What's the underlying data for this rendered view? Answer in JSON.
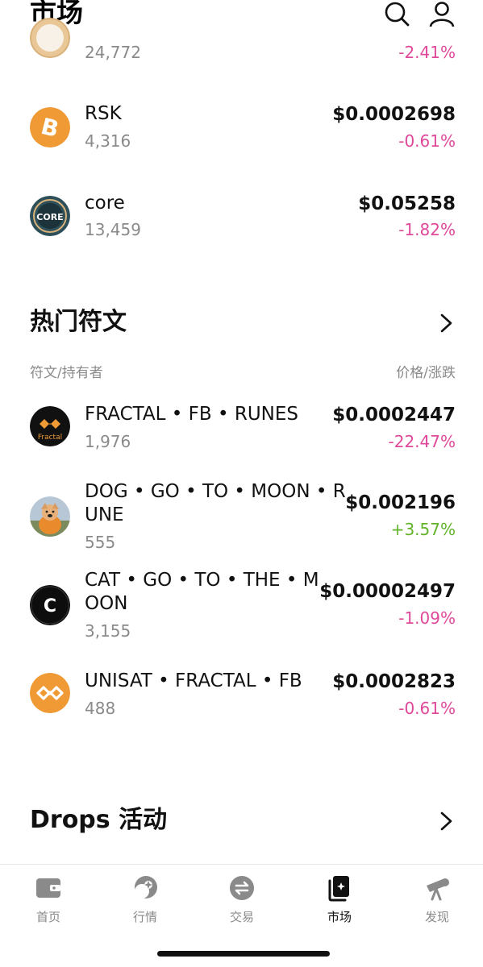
{
  "header": {
    "title": "市场",
    "search_icon": "search-icon",
    "profile_icon": "person-icon"
  },
  "top_list": [
    {
      "name": "",
      "holders": "24,772",
      "price": "",
      "change": "-2.41%",
      "change_dir": "neg"
    },
    {
      "name": "RSK",
      "holders": "4,316",
      "price": "$0.0002698",
      "change": "-0.61%",
      "change_dir": "neg"
    },
    {
      "name": "core",
      "holders": "13,459",
      "price": "$0.05258",
      "change": "-1.82%",
      "change_dir": "neg"
    }
  ],
  "hot_runes": {
    "title": "热门符文",
    "col_left": "符文/持有者",
    "col_right": "价格/涨跌",
    "items": [
      {
        "name_line1": "FRACTAL • FB • RUNES",
        "name_line2": "",
        "holders": "1,976",
        "price": "$0.0002447",
        "change": "-22.47%",
        "change_dir": "neg"
      },
      {
        "name_line1": "DOG • GO • TO • MOON • R",
        "name_line2": "UNE",
        "holders": "555",
        "price": "$0.002196",
        "change": "+3.57%",
        "change_dir": "pos"
      },
      {
        "name_line1": "CAT • GO • TO • THE • M",
        "name_line2": "OON",
        "holders": "3,155",
        "price": "$0.00002497",
        "change": "-1.09%",
        "change_dir": "neg"
      },
      {
        "name_line1": "UNISAT • FRACTAL • FB",
        "name_line2": "",
        "holders": "488",
        "price": "$0.0002823",
        "change": "-0.61%",
        "change_dir": "neg"
      }
    ]
  },
  "drops": {
    "title": "Drops 活动"
  },
  "tabs": [
    {
      "label": "首页",
      "icon": "wallet-icon"
    },
    {
      "label": "行情",
      "icon": "market-icon"
    },
    {
      "label": "交易",
      "icon": "swap-icon"
    },
    {
      "label": "市场",
      "icon": "nft-icon",
      "active": true
    },
    {
      "label": "发现",
      "icon": "telescope-icon"
    }
  ],
  "coin_logos": {
    "core_text": "CORE",
    "fractal_text": "Fractal",
    "cat_letter": "C"
  },
  "colors": {
    "negative": "#e0489a",
    "positive": "#62b32a",
    "bitcoin_orange": "#f09a36",
    "muted": "#8a8a8a"
  }
}
